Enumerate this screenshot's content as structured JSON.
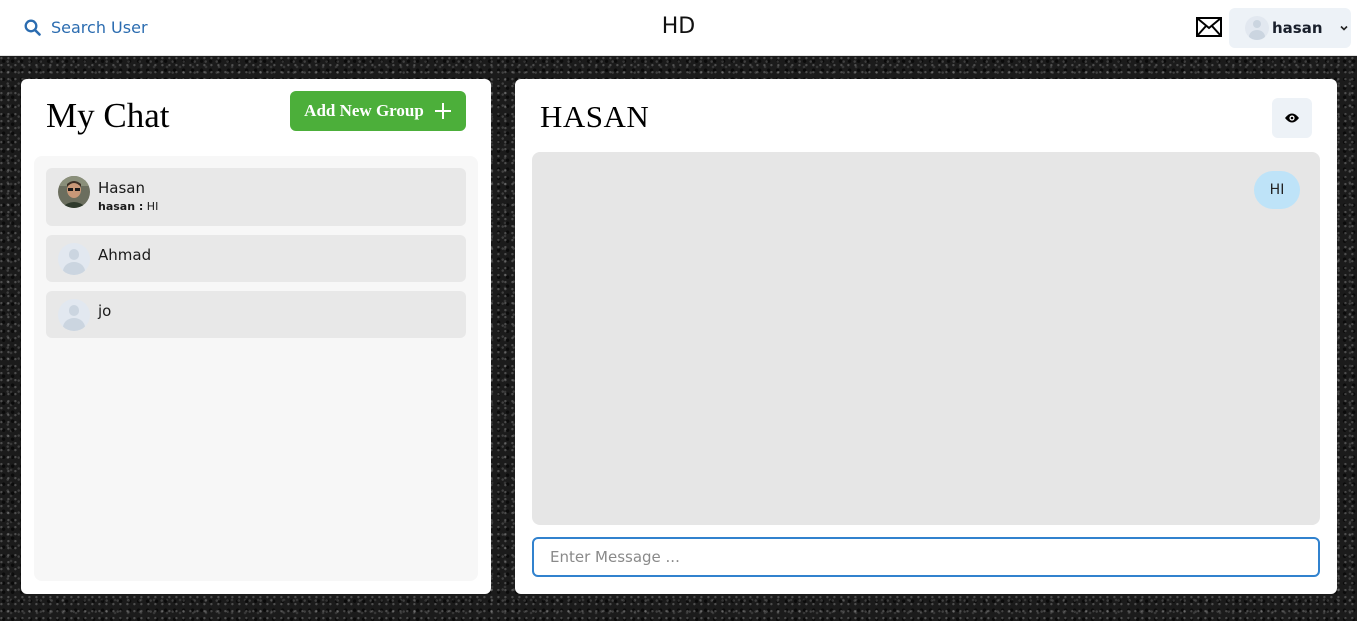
{
  "header": {
    "search_label": "Search User",
    "brand": "HD",
    "user_name": "hasan"
  },
  "sidebar": {
    "title": "My Chat",
    "add_group_label": "Add New Group",
    "chats": [
      {
        "name": "Hasan",
        "sender": "hasan :",
        "preview": "HI"
      },
      {
        "name": "Ahmad"
      },
      {
        "name": "jo"
      }
    ]
  },
  "chat": {
    "title": "HASAN",
    "messages": [
      {
        "text": "HI",
        "from": "self"
      }
    ],
    "input_placeholder": "Enter Message ..."
  },
  "colors": {
    "accent": "#3182ce",
    "add_button": "#4caf3a",
    "bubble": "#bee3f8"
  }
}
